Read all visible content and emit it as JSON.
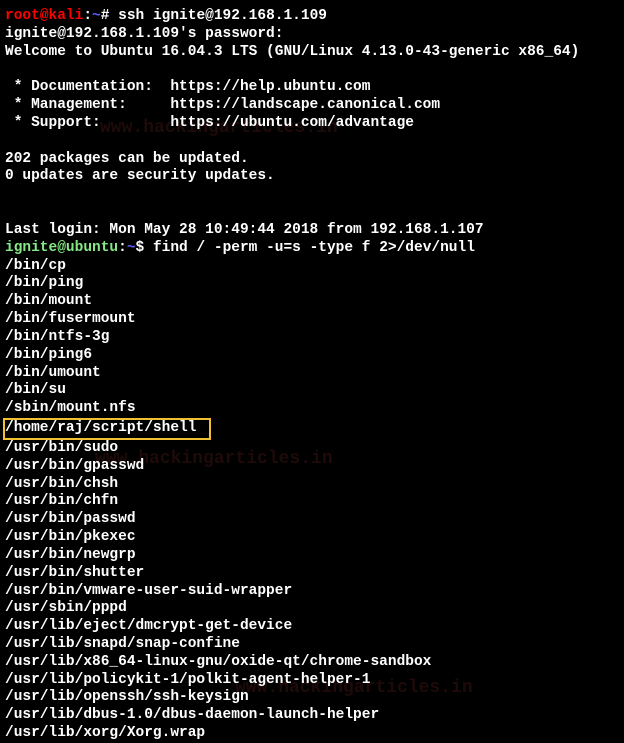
{
  "prompt1": {
    "user": "root",
    "at": "@",
    "host": "kali",
    "sep": ":",
    "path": "~",
    "hash": "# ",
    "cmd": "ssh ignite@192.168.1.109"
  },
  "passwordLine": "ignite@192.168.1.109's password:",
  "welcome": "Welcome to Ubuntu 16.04.3 LTS (GNU/Linux 4.13.0-43-generic x86_64)",
  "blank": " ",
  "doc": " * Documentation:  https://help.ubuntu.com",
  "mgmt": " * Management:     https://landscape.canonical.com",
  "support": " * Support:        https://ubuntu.com/advantage",
  "packages": "202 packages can be updated.",
  "security": "0 updates are security updates.",
  "lastLogin": "Last login: Mon May 28 10:49:44 2018 from 192.168.1.107",
  "prompt2": {
    "user": "ignite",
    "at": "@",
    "host": "ubuntu",
    "sep": ":",
    "path": "~",
    "dollar": "$ ",
    "cmd": "find / -perm -u=s -type f 2>/dev/null"
  },
  "results": [
    "/bin/cp",
    "/bin/ping",
    "/bin/mount",
    "/bin/fusermount",
    "/bin/ntfs-3g",
    "/bin/ping6",
    "/bin/umount",
    "/bin/su",
    "/sbin/mount.nfs"
  ],
  "highlighted": "/home/raj/script/shell ",
  "results2": [
    "/usr/bin/sudo",
    "/usr/bin/gpasswd",
    "/usr/bin/chsh",
    "/usr/bin/chfn",
    "/usr/bin/passwd",
    "/usr/bin/pkexec",
    "/usr/bin/newgrp",
    "/usr/bin/shutter",
    "/usr/bin/vmware-user-suid-wrapper",
    "/usr/sbin/pppd",
    "/usr/lib/eject/dmcrypt-get-device",
    "/usr/lib/snapd/snap-confine",
    "/usr/lib/x86_64-linux-gnu/oxide-qt/chrome-sandbox",
    "/usr/lib/policykit-1/polkit-agent-helper-1",
    "/usr/lib/openssh/ssh-keysign",
    "/usr/lib/dbus-1.0/dbus-daemon-launch-helper",
    "/usr/lib/xorg/Xorg.wrap"
  ],
  "watermark": "www.hackingarticles.in"
}
